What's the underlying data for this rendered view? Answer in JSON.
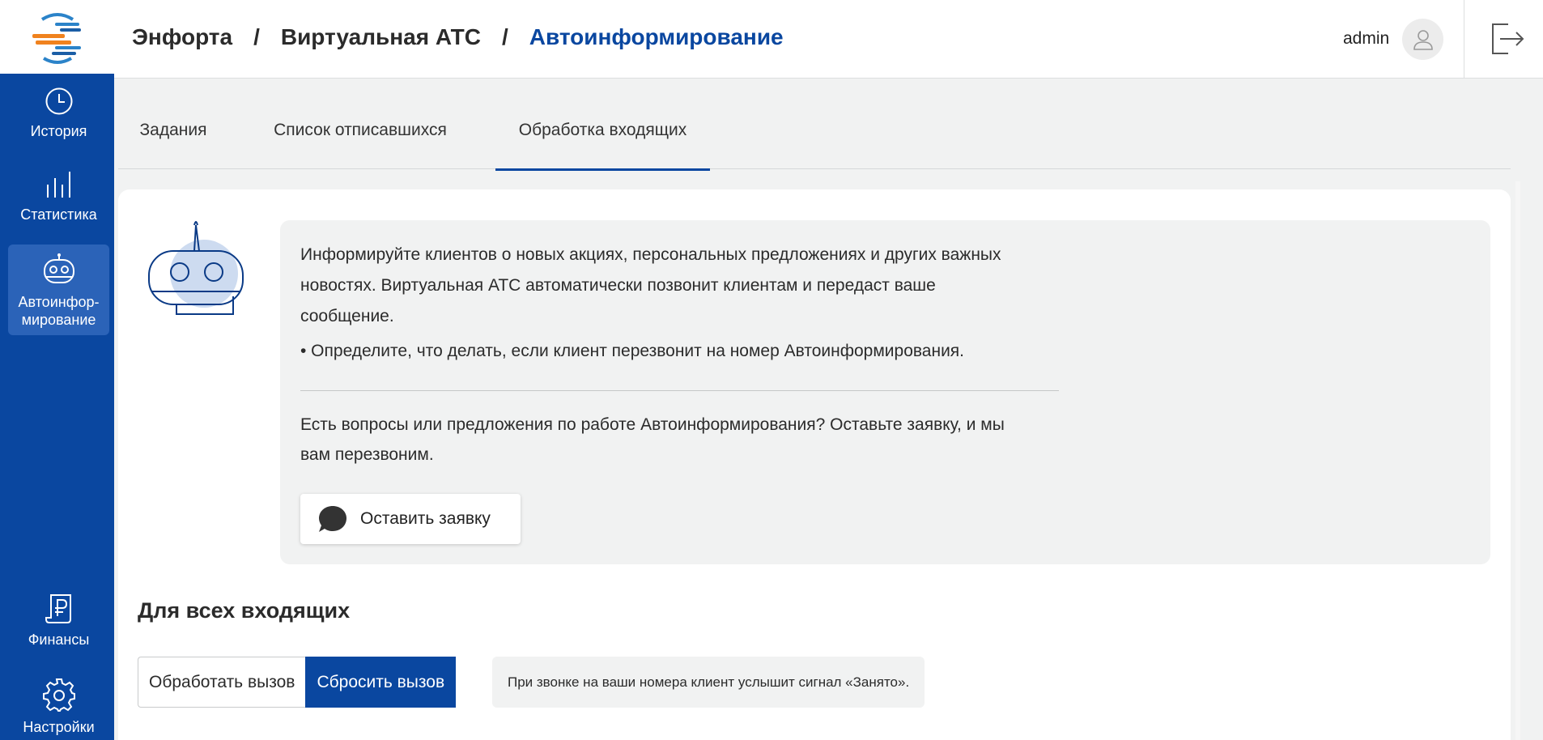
{
  "sidebar": {
    "items": [
      {
        "label": "История",
        "icon": "clock-icon"
      },
      {
        "label": "Статистика",
        "icon": "bar-chart-icon"
      },
      {
        "label": "Автоинфор-\nмирование",
        "icon": "robot-icon",
        "active": true
      },
      {
        "label": "Финансы",
        "icon": "ruble-document-icon"
      },
      {
        "label": "Настройки",
        "icon": "gear-icon"
      }
    ],
    "bg_color": "#0a47a0"
  },
  "header": {
    "breadcrumb": [
      "Энфорта",
      "Виртуальная АТС",
      "Автоинформирование"
    ],
    "separator": "/",
    "user": "admin"
  },
  "tabs": [
    {
      "label": "Задания"
    },
    {
      "label": "Список отписавшихся"
    },
    {
      "label": "Обработка входящих",
      "active": true
    }
  ],
  "info": {
    "paragraph": "Информируйте клиентов о новых акциях, персональных предложениях и других важных новостях. Виртуальная АТС автоматически позвонит клиентам и передаст ваше сообщение.",
    "bullet": "• Определите, что делать, если клиент перезвонит на номер Автоинформирования.",
    "question": "Есть вопросы или предложения по работе Автоинформирования? Оставьте заявку, и мы вам перезвоним.",
    "button_label": "Оставить заявку"
  },
  "section": {
    "title": "Для всех входящих",
    "options": [
      "Обработать вызов",
      "Сбросить вызов"
    ],
    "selected": "Сбросить вызов",
    "hint": "При звонке на ваши номера клиент услышит сигнал «Занято»."
  },
  "colors": {
    "accent": "#0a47a0",
    "panel": "#f1f2f2"
  }
}
